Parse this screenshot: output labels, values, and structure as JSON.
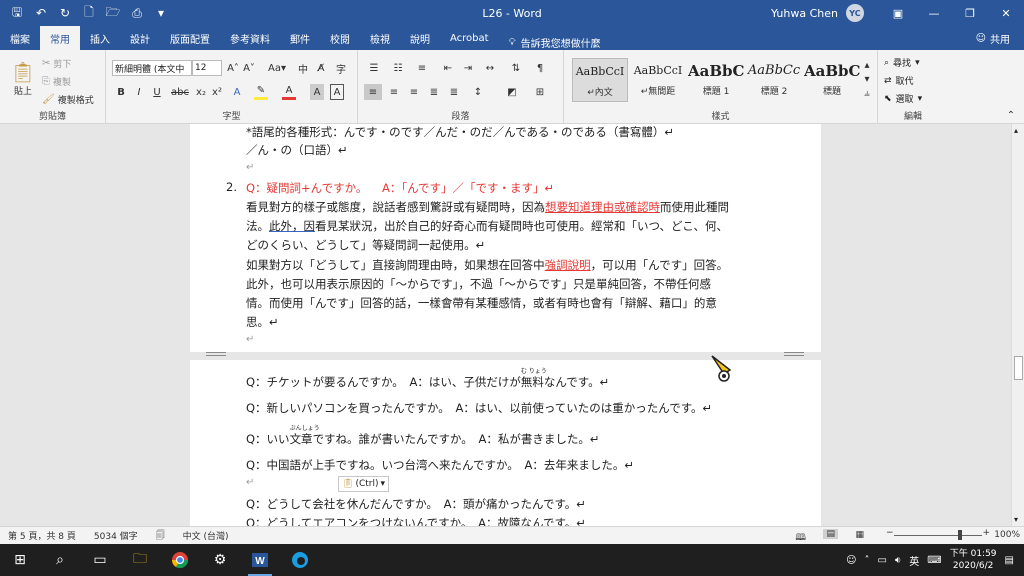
{
  "window": {
    "title": "L26 - Word",
    "user": "Yuhwa Chen",
    "user_initials": "YC"
  },
  "tabs": [
    "檔案",
    "常用",
    "插入",
    "設計",
    "版面配置",
    "參考資料",
    "郵件",
    "校閱",
    "檢視",
    "說明",
    "Acrobat"
  ],
  "active_tab": "常用",
  "tell_me": "告訴我您想做什麼",
  "share": "共用",
  "ribbon": {
    "clipboard": {
      "label": "剪貼簿",
      "paste": "貼上",
      "cut": "剪下",
      "copy": "複製",
      "format_painter": "複製格式"
    },
    "font": {
      "label": "字型",
      "font_name": "新細明體 (本文中",
      "font_size": "12"
    },
    "paragraph": {
      "label": "段落"
    },
    "styles": {
      "label": "樣式",
      "items": [
        {
          "sample": "AaBbCcI",
          "name": "↵內文"
        },
        {
          "sample": "AaBbCcI",
          "name": "↵無間距"
        },
        {
          "sample": "AaBbC",
          "name": "標題 1"
        },
        {
          "sample": "AaBbCc",
          "name": "標題 2"
        },
        {
          "sample": "AaBbC",
          "name": "標題"
        }
      ]
    },
    "editing": {
      "label": "編輯",
      "find": "尋找",
      "replace": "取代",
      "select": "選取"
    }
  },
  "doc": {
    "page1": {
      "l1": "*語尾的各種形式：んです・のです／んだ・のだ／んである・のである（書寫體）↵",
      "l2": "／ん・の（口語）↵",
      "l3": "↵",
      "num": "2.",
      "l4_q": "Q：疑問詞+んですか。",
      "l4_a": "A：「んです」／「です・ます」↵",
      "l5a": "看見對方的樣子或態度，說話者感到驚訝或有疑問時，因為",
      "l5b": "想要知道理由或確認時",
      "l5c": "而使用此種問",
      "l6a": "法。",
      "l6b": "此外，因",
      "l6c": "看見某狀況，出於自己的好奇心而有疑問時也可使用。經常和「いつ、どこ、何、",
      "l7": "どのくらい、どうして」等疑問詞一起使用。↵",
      "l8a": "如果對方以「どうして」直接詢問理由時，如果想在回答中",
      "l8b": "強調說明",
      "l8c": "，可以用「んです」回答。",
      "l9": "此外，也可以用表示原因的「～からです」，不過「～からです」只是單純回答，不帶任何感",
      "l10": "情。而使用「んです」回答的話，一樣會帶有某種感情，或者有時也會有「辯解、藉口」的意",
      "l11": "思。↵",
      "l12": "↵"
    },
    "page2": {
      "s1a": "Q：チケットが要るんですか。　A：はい、子供だけが",
      "s1_ruby": "無料",
      "s1_rt": "む りょう",
      "s1b": "なんです。↵",
      "s2": "Q：新しいパソコンを買ったんですか。　A：はい、以前使っていたのは重かったんです。↵",
      "s3a": "Q：いい",
      "s3_ruby": "文章",
      "s3_rt": "ぶんしょう",
      "s3b": "ですね。誰が書いたんですか。　A：私が書きました。↵",
      "s4": "Q：中国語が上手ですね。いつ台湾へ来たんですか。　A：去年来ました。↵",
      "s5": "↵",
      "s6": "Q：どうして会社を休んだんですか。　A：頭が痛かったんです。↵",
      "s7": "Q：どうしてエアコンをつけないんですか。　A：故障なんです。↵"
    },
    "ctrl_label": "(Ctrl)"
  },
  "status": {
    "page": "第 5 頁，共 8 頁",
    "words": "5034 個字",
    "language": "中文 (台灣)",
    "zoom_pct": "100%",
    "zoom_level": 0.75
  },
  "taskbar": {
    "time": "下午 01:59",
    "date": "2020/6/2",
    "ime": "英"
  }
}
